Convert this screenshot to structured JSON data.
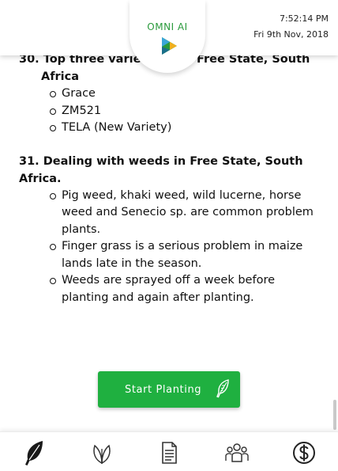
{
  "header": {
    "logo_text": "OMNI AI",
    "time": "7:52:14 PM",
    "date": "Fri 9th Nov, 2018"
  },
  "sections": [
    {
      "title_line1": "30. Top three varieties          e in Free State, South",
      "title_line2": "Africa",
      "items": [
        "Grace",
        "ZM521",
        "TELA (New Variety)"
      ]
    },
    {
      "title_line1": "31. Dealing with weeds in Free State, South Africa.",
      "items": [
        "Pig weed, khaki weed, wild lucerne, horse weed and Senecio sp. are common problem plants.",
        "Finger grass is a serious problem in maize lands late in the season.",
        "Weeds are sprayed off a week before planting and again after planting."
      ]
    }
  ],
  "button": {
    "label": "Start Planting",
    "icon": "feather-icon",
    "color": "#1fb040"
  },
  "bottom_nav": [
    {
      "name": "feather-icon",
      "active": true
    },
    {
      "name": "leaf-icon"
    },
    {
      "name": "document-icon"
    },
    {
      "name": "people-icon"
    },
    {
      "name": "dollar-icon"
    }
  ],
  "accent_color": "#2a9a3c"
}
